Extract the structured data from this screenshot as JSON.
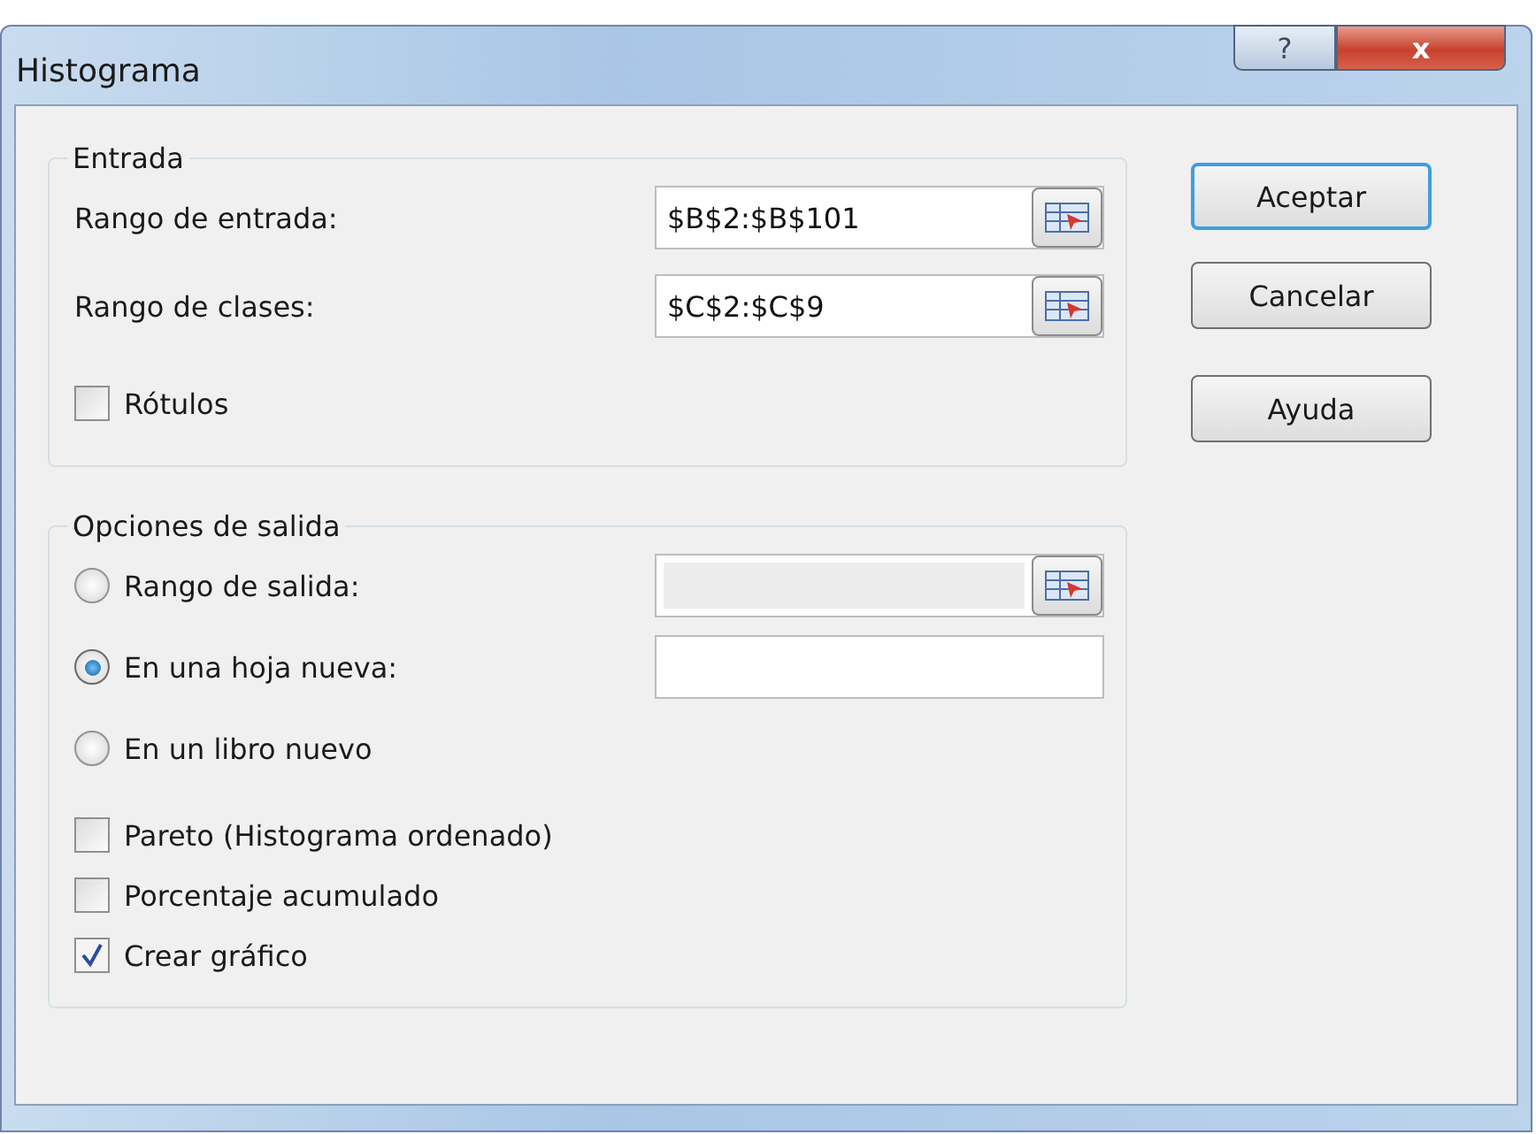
{
  "window": {
    "title": "Histograma",
    "title_buttons": [
      {
        "kind": "help",
        "label": "?"
      },
      {
        "kind": "close",
        "label": "x"
      }
    ]
  },
  "input_group": {
    "title": "Entrada",
    "fields": [
      {
        "label": "Rango de entrada:",
        "value": "$B$2:$B$101"
      },
      {
        "label": "Rango de clases:",
        "value": "$C$2:$C$9"
      }
    ],
    "checkboxes": [
      {
        "label": "Rótulos",
        "checked": false
      }
    ]
  },
  "output_group": {
    "title": "Opciones de salida",
    "options": [
      {
        "label": "Rango de salida:",
        "selected": false,
        "kind": "range"
      },
      {
        "label": "En una hoja nueva:",
        "selected": true,
        "kind": "text"
      },
      {
        "label": "En un libro nuevo",
        "selected": false,
        "kind": "plain"
      }
    ],
    "checkboxes": [
      {
        "label": "Pareto (Histograma ordenado)",
        "checked": false
      },
      {
        "label": "Porcentaje acumulado",
        "checked": false
      },
      {
        "label": "Crear gráfico",
        "checked": true
      }
    ]
  },
  "buttons": [
    {
      "label": "Aceptar",
      "default": true
    },
    {
      "label": "Cancelar",
      "default": false
    },
    {
      "label": "Ayuda",
      "default": false
    }
  ]
}
